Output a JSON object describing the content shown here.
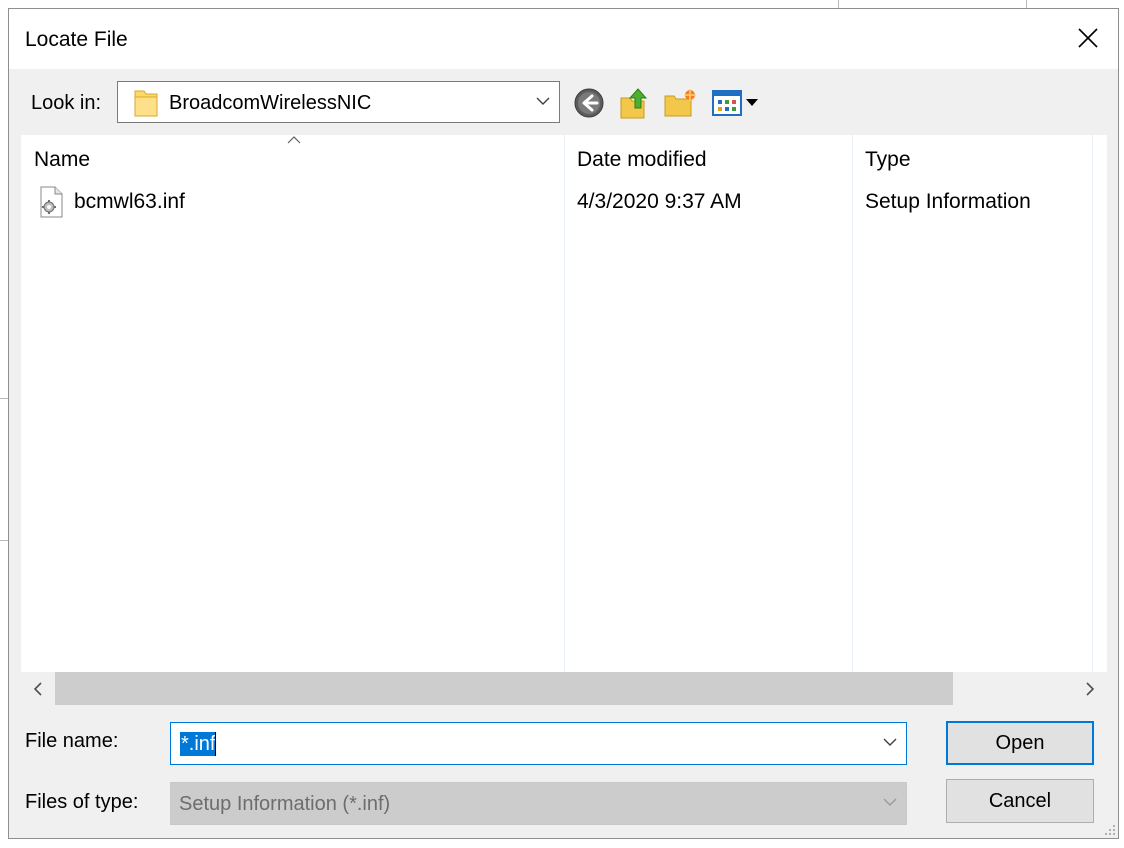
{
  "dialog": {
    "title": "Locate File",
    "close_icon": "close-icon"
  },
  "lookin": {
    "label": "Look in:",
    "value": "BroadcomWirelessNIC",
    "icon": "folder-icon"
  },
  "toolbar": {
    "back_icon": "back-arrow-icon",
    "up_icon": "up-folder-icon",
    "new_folder_icon": "new-folder-icon",
    "view_icon": "view-menu-icon"
  },
  "filelist": {
    "columns": [
      "Name",
      "Date modified",
      "Type"
    ],
    "rows": [
      {
        "name": "bcmwl63.inf",
        "date": "4/3/2020 9:37 AM",
        "type": "Setup Information",
        "icon": "inf-file-icon"
      }
    ]
  },
  "filename": {
    "label": "File name:",
    "value": "*.inf"
  },
  "filetype": {
    "label": "Files of type:",
    "value": "Setup Information (*.inf)"
  },
  "buttons": {
    "open": "Open",
    "cancel": "Cancel"
  },
  "colors": {
    "accent": "#0078d7",
    "dialog_bg": "#f0f0f0"
  }
}
